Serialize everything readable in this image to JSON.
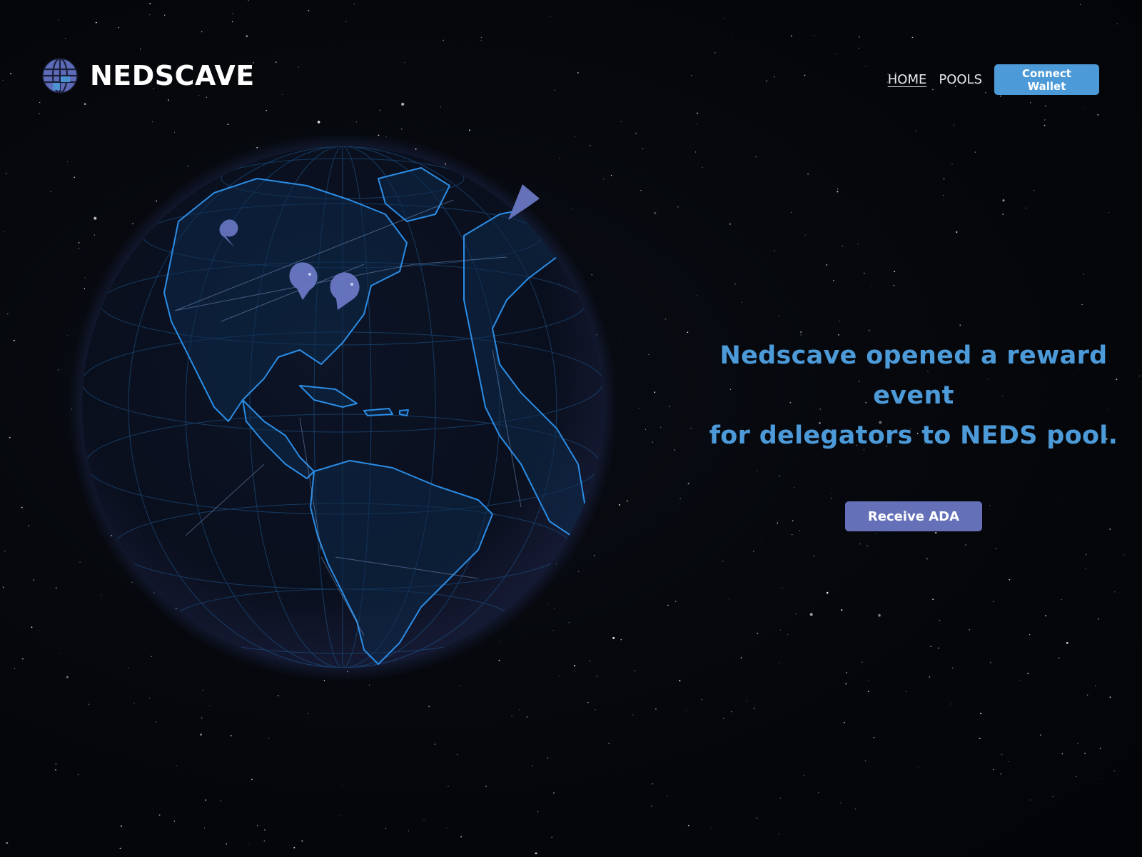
{
  "header": {
    "logo_text": "NEDSCAVE",
    "nav": [
      {
        "label": "HOME",
        "active": true
      },
      {
        "label": "POOLS",
        "active": false
      }
    ],
    "connect_wallet_label": "Connect Wallet"
  },
  "hero": {
    "title_line1": "Nedscave opened a reward event",
    "title_line2": "for delegators to NEDS pool.",
    "cta_label": "Receive ADA"
  },
  "globe": {
    "icon": "globe-map",
    "markers": [
      "map-pin-icon",
      "map-pin-icon",
      "map-pin-icon",
      "map-pin-icon"
    ]
  },
  "colors": {
    "background": "#05070b",
    "accent_blue": "#4d9ad9",
    "button_purple": "#6470b8",
    "globe_line": "#1f7fd6",
    "marker": "#6a78c4"
  }
}
